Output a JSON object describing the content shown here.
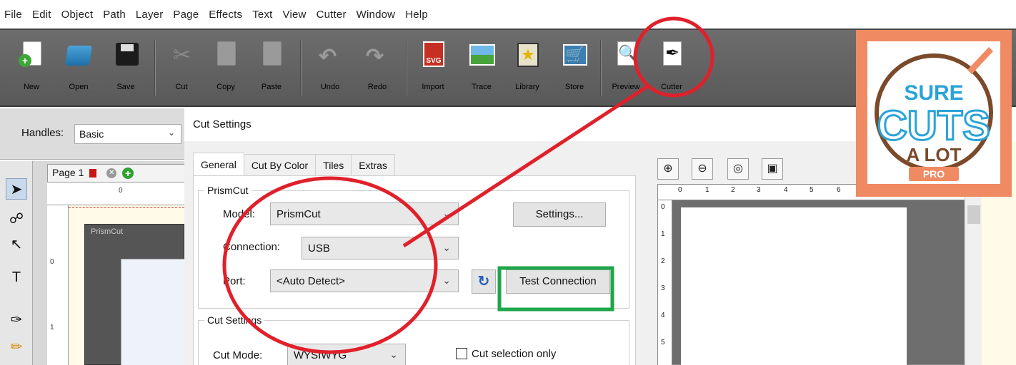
{
  "menu": [
    "File",
    "Edit",
    "Object",
    "Path",
    "Layer",
    "Page",
    "Effects",
    "Text",
    "View",
    "Cutter",
    "Window",
    "Help"
  ],
  "toolbar": {
    "new": "New",
    "open": "Open",
    "save": "Save",
    "cut": "Cut",
    "copy": "Copy",
    "paste": "Paste",
    "undo": "Undo",
    "redo": "Redo",
    "import": "Import",
    "trace": "Trace",
    "library": "Library",
    "store": "Store",
    "preview": "Preview",
    "cutter": "Cutter",
    "svg_badge": "SVG"
  },
  "handles": {
    "label": "Handles:",
    "value": "Basic"
  },
  "page_tab": {
    "label": "Page 1"
  },
  "workspace": {
    "ruler_top": [
      "0"
    ],
    "ruler_left": [
      "0",
      "1"
    ],
    "mat_label": "PrismCut"
  },
  "dialog": {
    "title": "Cut Settings",
    "tabs": [
      "General",
      "Cut By Color",
      "Tiles",
      "Extras"
    ],
    "device_group": "PrismCut",
    "model_label": "Model:",
    "model_value": "PrismCut",
    "connection_label": "Connection:",
    "connection_value": "USB",
    "port_label": "Port:",
    "port_value": "<Auto Detect>",
    "settings_button": "Settings...",
    "test_connection_button": "Test Connection",
    "cut_settings_group": "Cut Settings",
    "cut_mode_label": "Cut Mode:",
    "cut_mode_value": "WYSIWYG",
    "cut_selection_only": "Cut selection only"
  },
  "preview": {
    "ruler_top": [
      "0",
      "1",
      "2",
      "3",
      "4",
      "5",
      "6"
    ],
    "ruler_left": [
      "0",
      "1",
      "2",
      "3",
      "4",
      "5"
    ]
  },
  "logo": {
    "line1": "SURE",
    "line2": "CUTS",
    "line3": "A LOT",
    "badge": "PRO"
  },
  "colors": {
    "annotation_red": "#e0202a",
    "highlight_green": "#1fa64a",
    "logo_orange": "#f08a62",
    "logo_blue": "#2aa3d8",
    "logo_brown": "#7a4a2a"
  },
  "icons": [
    "new-icon",
    "open-icon",
    "save-icon",
    "cut-icon",
    "copy-icon",
    "paste-icon",
    "undo-icon",
    "redo-icon",
    "import-icon",
    "trace-icon",
    "library-icon",
    "store-icon",
    "preview-icon",
    "cutter-icon"
  ]
}
